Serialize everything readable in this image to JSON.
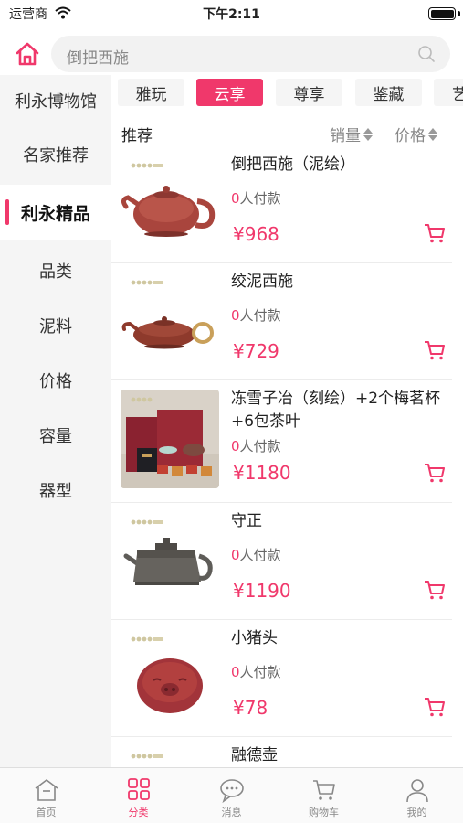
{
  "status_bar": {
    "carrier": "运营商",
    "time": "下午2:11"
  },
  "search": {
    "placeholder": "倒把西施"
  },
  "sidebar": {
    "items": [
      {
        "label": "利永博物馆",
        "active": false
      },
      {
        "label": "名家推荐",
        "active": false
      },
      {
        "label": "利永精品",
        "active": true
      },
      {
        "label": "品类",
        "active": false
      },
      {
        "label": "泥料",
        "active": false
      },
      {
        "label": "价格",
        "active": false
      },
      {
        "label": "容量",
        "active": false
      },
      {
        "label": "器型",
        "active": false
      }
    ]
  },
  "tabs": [
    {
      "label": "雅玩",
      "active": false
    },
    {
      "label": "云享",
      "active": true
    },
    {
      "label": "尊享",
      "active": false
    },
    {
      "label": "鉴藏",
      "active": false
    },
    {
      "label": "艺",
      "active": false
    }
  ],
  "sort": {
    "recommend": "推荐",
    "sales": "销量",
    "price": "价格"
  },
  "products": [
    {
      "title": "倒把西施（泥绘）",
      "sold_count": "0",
      "sold_suffix": "人付款",
      "price": "¥968",
      "image": "purple-clay-teapot"
    },
    {
      "title": "绞泥西施",
      "sold_count": "0",
      "sold_suffix": "人付款",
      "price": "¥729",
      "image": "red-clay-teapot-ring-handle"
    },
    {
      "title": "冻雪子冶（刻绘）+2个梅茗杯+6包茶叶",
      "sold_count": "0",
      "sold_suffix": "人付款",
      "price": "¥1180",
      "image": "gift-box-set"
    },
    {
      "title": "守正",
      "sold_count": "0",
      "sold_suffix": "人付款",
      "price": "¥1190",
      "image": "square-gray-teapot"
    },
    {
      "title": "小猪头",
      "sold_count": "0",
      "sold_suffix": "人付款",
      "price": "¥78",
      "image": "pig-head-figurine"
    },
    {
      "title": "融德壶",
      "sold_count": "",
      "sold_suffix": "",
      "price": "",
      "image": "teapot"
    }
  ],
  "bottom_nav": [
    {
      "label": "首页",
      "icon": "home-outline-icon",
      "active": false
    },
    {
      "label": "分类",
      "icon": "category-grid-icon",
      "active": true
    },
    {
      "label": "消息",
      "icon": "message-bubble-icon",
      "active": false
    },
    {
      "label": "购物车",
      "icon": "cart-icon",
      "active": false
    },
    {
      "label": "我的",
      "icon": "person-icon",
      "active": false
    }
  ],
  "colors": {
    "accent": "#f0386b",
    "sidebar_bg": "#f5f5f5",
    "tab_bg": "#f5f5f5"
  }
}
